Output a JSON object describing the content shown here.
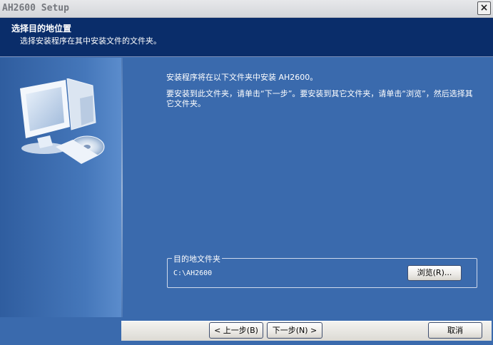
{
  "window": {
    "title": "AH2600 Setup",
    "close_label": "×"
  },
  "header": {
    "title": "选择目的地位置",
    "subtitle": "选择安装程序在其中安装文件的文件夹。"
  },
  "main": {
    "intro": "安装程序将在以下文件夹中安装 AH2600。",
    "instructions": "要安装到此文件夹，请单击“下一步”。要安装到其它文件夹，请单击“浏览”，然后选择其它文件夹。",
    "destination": {
      "legend": "目的地文件夹",
      "path": "C:\\AH2600",
      "browse_label": "浏览(R)..."
    }
  },
  "footer": {
    "back_label": "< 上一步(B)",
    "next_label": "下一步(N) >",
    "cancel_label": "取消"
  },
  "colors": {
    "panel_blue": "#3a6aad",
    "header_blue": "#0a2d6a"
  },
  "icons": [
    "computer-cd-icon",
    "close-icon"
  ]
}
